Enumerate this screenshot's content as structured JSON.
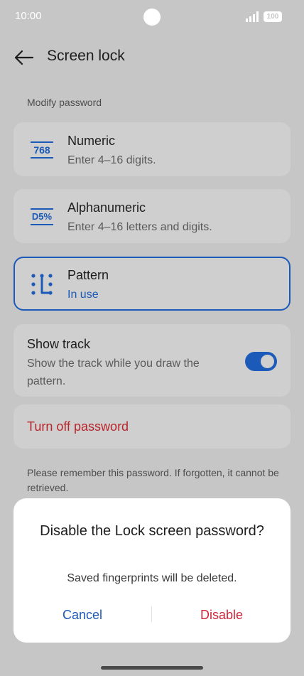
{
  "status_bar": {
    "time": "10:00",
    "battery": "100"
  },
  "header": {
    "title": "Screen lock"
  },
  "section_label": "Modify password",
  "options": [
    {
      "icon_text": "768",
      "icon": "numeric-icon",
      "title": "Numeric",
      "subtitle": "Enter 4–16 digits."
    },
    {
      "icon_text": "D5%",
      "icon": "alphanumeric-icon",
      "title": "Alphanumeric",
      "subtitle": "Enter 4–16 letters and digits."
    },
    {
      "icon": "pattern-icon",
      "title": "Pattern",
      "subtitle": "In use",
      "selected": true
    }
  ],
  "show_track": {
    "title": "Show track",
    "subtitle": "Show the track while you draw the pattern.",
    "enabled": true
  },
  "turn_off_label": "Turn off password",
  "note": "Please remember this password. If forgotten, it cannot be retrieved.",
  "dialog": {
    "title": "Disable the Lock screen password?",
    "message": "Saved fingerprints will be deleted.",
    "cancel": "Cancel",
    "confirm": "Disable"
  },
  "colors": {
    "accent": "#1b5ab8",
    "danger": "#d0263a",
    "background": "#c6c6c6"
  }
}
